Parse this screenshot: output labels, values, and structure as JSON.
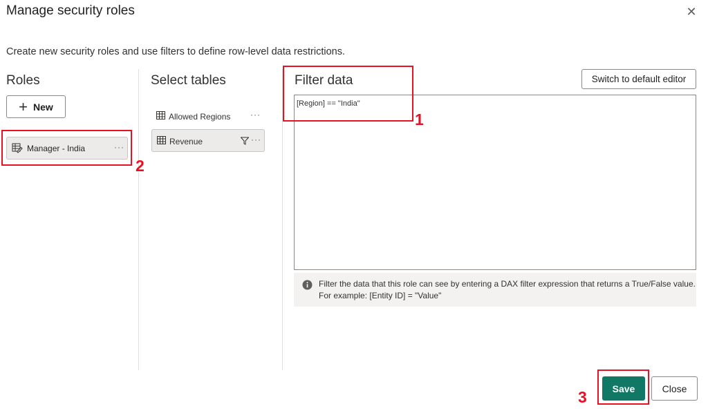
{
  "dialog": {
    "title": "Manage security roles",
    "subtitle": "Create new security roles and use filters to define row-level data restrictions."
  },
  "roles": {
    "heading": "Roles",
    "new_label": "New",
    "items": [
      {
        "label": "Manager - India",
        "more": "···"
      }
    ]
  },
  "tables": {
    "heading": "Select tables",
    "items": [
      {
        "label": "Allowed Regions",
        "more": "···"
      },
      {
        "label": "Revenue",
        "more": "···"
      }
    ]
  },
  "filter": {
    "heading": "Filter data",
    "switch_label": "Switch to default editor",
    "expression": "[Region] == \"India\"",
    "info_line1": "Filter the data that this role can see by entering a DAX filter expression that returns a True/False value.",
    "info_line2": "For example: [Entity ID] = \"Value\""
  },
  "footer": {
    "save_label": "Save",
    "close_label": "Close"
  },
  "annotations": {
    "one": "1",
    "two": "2",
    "three": "3",
    "color": "#e81123"
  },
  "colors": {
    "save_button": "#117865",
    "selected_item": "#edebe9",
    "info_background": "#f3f2f1"
  }
}
